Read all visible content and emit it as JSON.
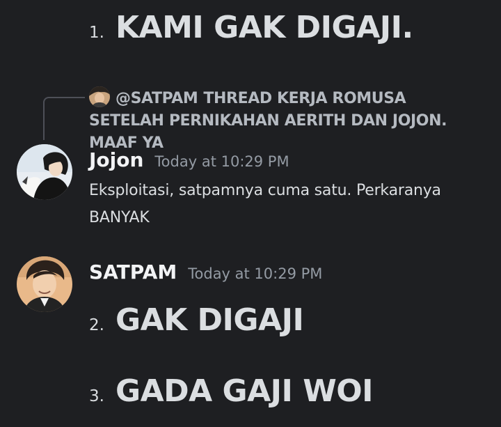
{
  "top_message": {
    "number": "1.",
    "text": "KAMI GAK DIGAJI."
  },
  "reply_reference": {
    "mention": "@SATPAM",
    "preview": "THREAD KERJA ROMUSA SETELAH PERNIKAHAN AERITH DAN JOJON. MAAF YA"
  },
  "messages": [
    {
      "author": "Jojon",
      "timestamp": "Today at 10:29 PM",
      "content": "Eksploitasi, satpamnya cuma satu. Perkaranya BANYAK"
    },
    {
      "author": "SATPAM",
      "timestamp": "Today at 10:29 PM",
      "list": [
        {
          "number": "2.",
          "text": "GAK DIGAJI"
        },
        {
          "number": "3.",
          "text": "GADA GAJI WOI"
        }
      ]
    }
  ],
  "colors": {
    "background": "#1e1f22",
    "text": "#dbdee1",
    "username": "#f2f3f5",
    "timestamp": "#949ba4",
    "reply_spine": "#4e5058"
  }
}
